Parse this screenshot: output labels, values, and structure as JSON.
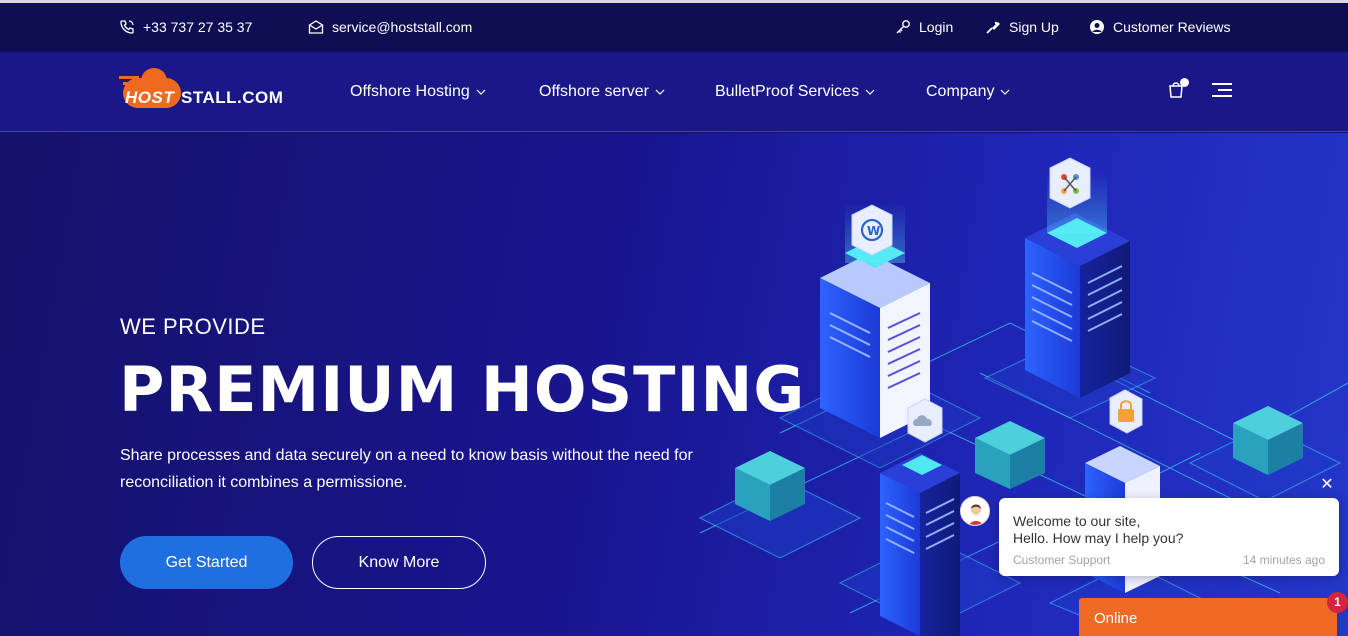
{
  "topbar": {
    "phone": "+33 737 27 35 37",
    "email": "service@hoststall.com",
    "login": "Login",
    "signup": "Sign Up",
    "reviews": "Customer Reviews"
  },
  "logo": {
    "part1": "HOST",
    "part2": "STALL.COM"
  },
  "nav": {
    "items": [
      {
        "label": "Offshore Hosting"
      },
      {
        "label": "Offshore server"
      },
      {
        "label": "BulletProof Services"
      },
      {
        "label": "Company"
      }
    ]
  },
  "hero": {
    "kicker": "WE PROVIDE",
    "headline": "PREMIUM HOSTING",
    "sub": "Share processes and data securely on a need to know basis without the need for reconciliation it combines a permissione.",
    "primary_button": "Get Started",
    "secondary_button": "Know More"
  },
  "chat": {
    "message_line1": "Welcome to our site,",
    "message_line2": "Hello. How may I help you?",
    "agent": "Customer Support",
    "time": "14 minutes ago",
    "close": "✕",
    "status": "Online",
    "badge": "1"
  },
  "icons": [
    "phone-icon",
    "mail-icon",
    "key-icon",
    "signup-icon",
    "user-icon",
    "cart-icon",
    "menu-icon",
    "chevron-down-icon",
    "wordpress-icon",
    "joomla-icon",
    "cloud-icon",
    "lock-icon"
  ],
  "colors": {
    "topbar": "#0f0e52",
    "nav": "#1a1888",
    "primary_button": "#1f6fe0",
    "chat_online": "#ee6a25",
    "badge": "#d1263c"
  }
}
